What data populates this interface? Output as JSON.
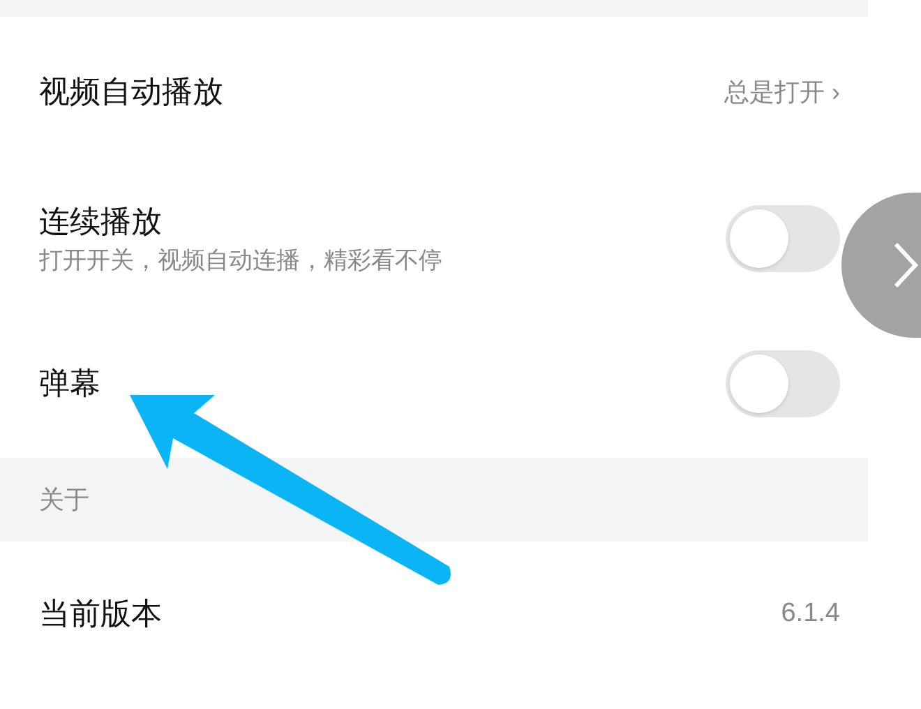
{
  "settings": [
    {
      "kind": "link",
      "label": "视频自动播放",
      "value": "总是打开",
      "chevron": "›"
    },
    {
      "kind": "toggle",
      "label": "连续播放",
      "description": "打开开关，视频自动连播，精彩看不停",
      "on": false
    },
    {
      "kind": "toggle",
      "label": "弹幕",
      "on": false
    }
  ],
  "about": {
    "header": "关于",
    "items": [
      {
        "kind": "info",
        "label": "当前版本",
        "value": "6.1.4"
      }
    ]
  }
}
